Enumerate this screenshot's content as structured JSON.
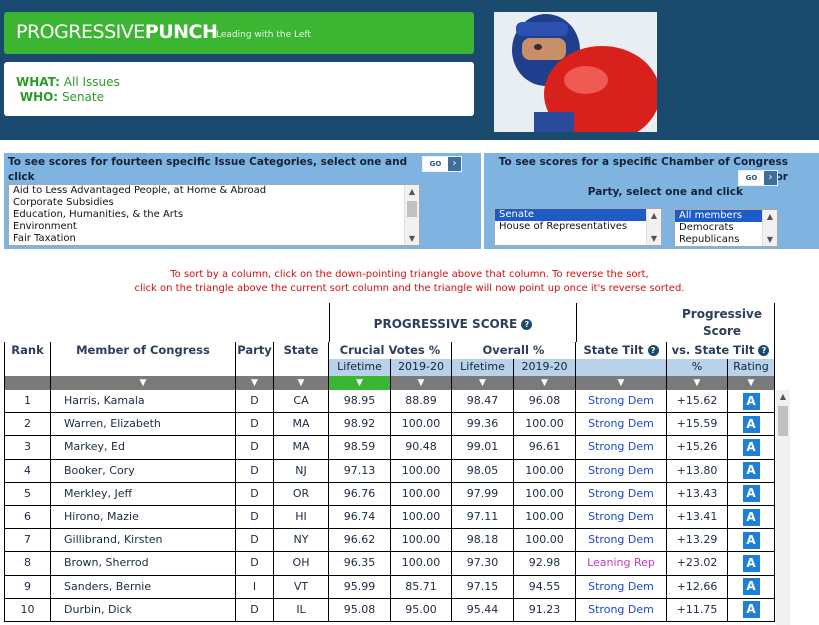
{
  "header": {
    "logo_main": "PROGRESSIVE",
    "logo_bold": "PUNCH",
    "logo_tagline": "Leading with the Left",
    "what_label": "WHAT:",
    "what_value": "All Issues",
    "who_label": "WHO:",
    "who_value": "Senate"
  },
  "issue_selector": {
    "label": "To see scores for fourteen specific Issue Categories, select one and click",
    "go_label": "GO",
    "options": [
      "Aid to Less Advantaged People, at Home & Abroad",
      "Corporate Subsidies",
      "Education, Humanities, & the Arts",
      "Environment",
      "Fair Taxation"
    ]
  },
  "chamber_selector": {
    "label_line1": "To see scores for a specific Chamber of Congress or",
    "label_line2": "Party, select one and click",
    "go_label": "GO",
    "chamber_options": [
      "Senate",
      "House of Representatives"
    ],
    "chamber_selected": "Senate",
    "party_options": [
      "All members",
      "Democrats",
      "Republicans"
    ],
    "party_selected": "All members"
  },
  "instructions": {
    "line1": "To sort by a column, click on the down-pointing triangle above that column. To reverse the sort,",
    "line2": "click on the triangle above the current sort column and the triangle will now point up once it's reverse sorted."
  },
  "table": {
    "group_progressive_score": "PROGRESSIVE SCORE",
    "group_prog_score_line1": "Progressive",
    "group_prog_score_line2": "Score",
    "columns": {
      "rank": "Rank",
      "member": "Member of Congress",
      "party": "Party",
      "state": "State",
      "crucial": "Crucial Votes %",
      "overall": "Overall %",
      "tilt": "State Tilt",
      "vs_tilt": "vs. State Tilt"
    },
    "subcolumns": {
      "lifetime": "Lifetime",
      "period": "2019-20",
      "pct": "%",
      "rating": "Rating"
    },
    "sort_down": "▼",
    "help_icon": "?",
    "rows": [
      {
        "rank": "1",
        "name": "Harris, Kamala",
        "party": "D",
        "state": "CA",
        "cv_life": "98.95",
        "cv_1920": "88.89",
        "ov_life": "98.47",
        "ov_1920": "96.08",
        "tilt": "Strong Dem",
        "vs": "+15.62",
        "rating": "A"
      },
      {
        "rank": "2",
        "name": "Warren, Elizabeth",
        "party": "D",
        "state": "MA",
        "cv_life": "98.92",
        "cv_1920": "100.00",
        "ov_life": "99.36",
        "ov_1920": "100.00",
        "tilt": "Strong Dem",
        "vs": "+15.59",
        "rating": "A"
      },
      {
        "rank": "3",
        "name": "Markey, Ed",
        "party": "D",
        "state": "MA",
        "cv_life": "98.59",
        "cv_1920": "90.48",
        "ov_life": "99.01",
        "ov_1920": "96.61",
        "tilt": "Strong Dem",
        "vs": "+15.26",
        "rating": "A"
      },
      {
        "rank": "4",
        "name": "Booker, Cory",
        "party": "D",
        "state": "NJ",
        "cv_life": "97.13",
        "cv_1920": "100.00",
        "ov_life": "98.05",
        "ov_1920": "100.00",
        "tilt": "Strong Dem",
        "vs": "+13.80",
        "rating": "A"
      },
      {
        "rank": "5",
        "name": "Merkley, Jeff",
        "party": "D",
        "state": "OR",
        "cv_life": "96.76",
        "cv_1920": "100.00",
        "ov_life": "97.99",
        "ov_1920": "100.00",
        "tilt": "Strong Dem",
        "vs": "+13.43",
        "rating": "A"
      },
      {
        "rank": "6",
        "name": "Hirono, Mazie",
        "party": "D",
        "state": "HI",
        "cv_life": "96.74",
        "cv_1920": "100.00",
        "ov_life": "97.11",
        "ov_1920": "100.00",
        "tilt": "Strong Dem",
        "vs": "+13.41",
        "rating": "A"
      },
      {
        "rank": "7",
        "name": "Gillibrand, Kirsten",
        "party": "D",
        "state": "NY",
        "cv_life": "96.62",
        "cv_1920": "100.00",
        "ov_life": "98.18",
        "ov_1920": "100.00",
        "tilt": "Strong Dem",
        "vs": "+13.29",
        "rating": "A"
      },
      {
        "rank": "8",
        "name": "Brown, Sherrod",
        "party": "D",
        "state": "OH",
        "cv_life": "96.35",
        "cv_1920": "100.00",
        "ov_life": "97.30",
        "ov_1920": "92.98",
        "tilt": "Leaning Rep",
        "vs": "+23.02",
        "rating": "A"
      },
      {
        "rank": "9",
        "name": "Sanders, Bernie",
        "party": "I",
        "state": "VT",
        "cv_life": "95.99",
        "cv_1920": "85.71",
        "ov_life": "97.15",
        "ov_1920": "94.55",
        "tilt": "Strong Dem",
        "vs": "+12.66",
        "rating": "A"
      },
      {
        "rank": "10",
        "name": "Durbin, Dick",
        "party": "D",
        "state": "IL",
        "cv_life": "95.08",
        "cv_1920": "95.00",
        "ov_life": "95.44",
        "ov_1920": "91.23",
        "tilt": "Strong Dem",
        "vs": "+11.75",
        "rating": "A"
      }
    ]
  },
  "colors": {
    "header_bg": "#1a4a6e",
    "logo_green": "#3cb533",
    "panel_blue": "#7fb4e0",
    "strong_dem": "#1c48c7",
    "leaning_rep": "#c43bb3",
    "rating_blue": "#1e7fd8",
    "instruction_red": "#d01010"
  }
}
